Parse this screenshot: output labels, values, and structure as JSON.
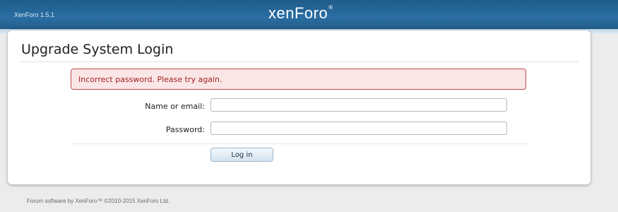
{
  "header": {
    "version": "XenForo 1.5.1",
    "logo_text": "xenForo",
    "logo_mark": "®"
  },
  "main": {
    "title": "Upgrade System Login",
    "error_message": "Incorrect password. Please try again.",
    "fields": {
      "login_label": "Name or email:",
      "login_value": "",
      "password_label": "Password:",
      "password_value": ""
    },
    "submit_label": "Log in"
  },
  "footer": {
    "copyright": "Forum software by XenForo™ ©2010-2015 XenForo Ltd."
  },
  "colors": {
    "header": "#2a6ea3",
    "error_bg": "#fae6e6",
    "error_border": "#c24b4b",
    "error_text": "#a42121"
  }
}
